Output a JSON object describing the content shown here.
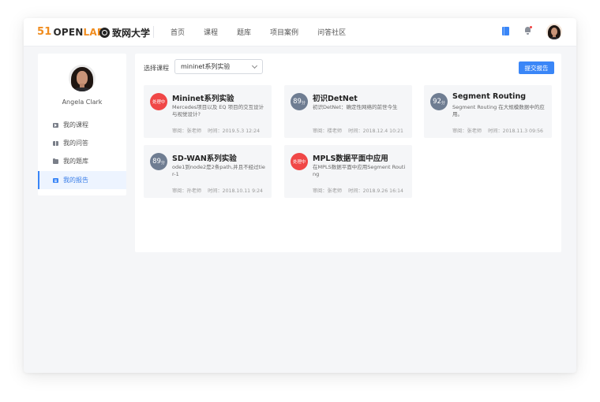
{
  "header": {
    "logo_number": "51",
    "logo_open": "OPEN",
    "logo_lab": "LAB",
    "university": "致网大学",
    "nav": [
      "首页",
      "课程",
      "题库",
      "项目案例",
      "问答社区"
    ]
  },
  "sidebar": {
    "user_name": "Angela Clark",
    "items": [
      {
        "label": "我的课程",
        "icon": "video-icon"
      },
      {
        "label": "我的问答",
        "icon": "qa-icon"
      },
      {
        "label": "我的题库",
        "icon": "folder-icon"
      },
      {
        "label": "我的报告",
        "icon": "report-icon",
        "active": true
      }
    ]
  },
  "content": {
    "select_label": "选择课程",
    "select_value": "mininet系列实验",
    "submit_label": "提交报告",
    "reports": [
      {
        "badge": "处理中",
        "badge_type": "processing",
        "title": "Mininet系列实验",
        "desc": "Mercedes项目以及 EQ 项目的交互设计与视觉设计?",
        "reviewer": "审阅：张老师",
        "time": "时间：2019.5.3 12:24"
      },
      {
        "badge": "89",
        "badge_unit": "分",
        "badge_type": "score",
        "title": "初识DetNet",
        "desc": "初识DetNet：确定性网络的前世今生",
        "reviewer": "审阅：楼老师",
        "time": "时间：2018.12.4 10:21"
      },
      {
        "badge": "92",
        "badge_unit": "分",
        "badge_type": "score",
        "title": "Segment Routing",
        "desc": "Segment Routing 在大规模数据中的应用。",
        "reviewer": "审阅：张老师",
        "time": "时间：2018.11.3 09:56"
      },
      {
        "badge": "89",
        "badge_unit": "分",
        "badge_type": "score",
        "title": "SD-WAN系列实验",
        "desc": "ode1到node2是2条path,并且不经过tier-1",
        "reviewer": "审阅：孙老师",
        "time": "时间：2018.10.11 9:24"
      },
      {
        "badge": "处理中",
        "badge_type": "processing",
        "title": "MPLS数据平面中应用",
        "desc": "在MPLS数据平面中应用Segment Routing",
        "reviewer": "审阅：张老师",
        "time": "时间：2018.9.26 16:14"
      }
    ]
  },
  "colors": {
    "accent": "#3a86f7",
    "processing": "#f04747",
    "score": "#6f7d92",
    "logo_orange": "#f08c1e"
  }
}
